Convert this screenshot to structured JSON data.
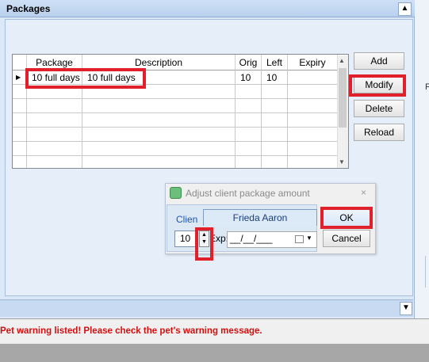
{
  "panel": {
    "title": "Packages",
    "collapse_glyph": "▲",
    "expand_glyph": "▼"
  },
  "grid": {
    "columns": [
      "Package",
      "Description",
      "Orig",
      "Left",
      "Expiry"
    ],
    "row_marker": "▶",
    "rows": [
      {
        "package": "10 full days",
        "description": "10 full days",
        "orig": "10",
        "left": "10",
        "expiry": ""
      }
    ]
  },
  "actions": {
    "add": "Add",
    "modify": "Modify",
    "delete": "Delete",
    "reload": "Reload"
  },
  "dialog": {
    "title": "Adjust client package amount",
    "close_glyph": "×",
    "client_label": "Clien",
    "client_name": "Frieda Aaron",
    "amount": "10",
    "exp_label": "Exp:",
    "exp_value": "__/__/___",
    "ok": "OK",
    "cancel": "Cancel"
  },
  "side": {
    "fragment": "F"
  },
  "status": {
    "warning": "Pet warning listed! Please check the pet's warning message.",
    "warning_color": "#d01010"
  },
  "colors": {
    "highlight": "#e0202a",
    "panel_bg": "#dbe8f7"
  }
}
